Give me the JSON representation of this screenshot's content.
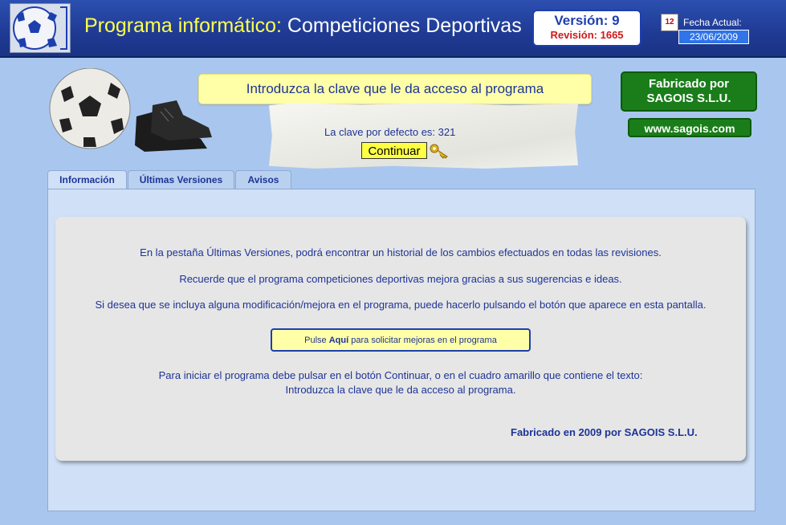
{
  "header": {
    "title_prefix": "Programa informático:",
    "title_main": "Competiciones Deportivas",
    "version_label": "Versión:",
    "version_value": "9",
    "revision_label": "Revisión:",
    "revision_value": "1665",
    "date_label": "Fecha Actual:",
    "date_value": "23/06/2009",
    "calendar_day": "12"
  },
  "login": {
    "prompt": "Introduzca la clave que le da acceso al programa",
    "default_key_text": "La clave por defecto es: 321",
    "continue_label": "Continuar"
  },
  "vendor": {
    "made_by_line1": "Fabricado por",
    "made_by_line2": "SAGOIS S.L.U.",
    "website": "www.sagois.com"
  },
  "tabs": [
    {
      "label": "Información",
      "active": true
    },
    {
      "label": "Últimas Versiones",
      "active": false
    },
    {
      "label": "Avisos",
      "active": false
    }
  ],
  "info": {
    "line1": "En la pestaña Últimas Versiones, podrá encontrar un historial de los cambios efectuados en todas las revisiones.",
    "line2": "Recuerde que el programa competiciones deportivas mejora gracias a sus sugerencias e ideas.",
    "line3": "Si desea que se incluya alguna modificación/mejora en el programa, puede hacerlo pulsando el botón que aparece en esta pantalla.",
    "request_pre": "Pulse ",
    "request_bold": "Aquí",
    "request_post": " para solicitar mejoras en el programa",
    "line4": "Para iniciar el programa debe pulsar en el botón Continuar, o en el cuadro amarillo que contiene el texto:",
    "line5": "Introduzca la clave que le da acceso al programa.",
    "footer": "Fabricado en 2009 por SAGOIS S.L.U."
  },
  "colors": {
    "background": "#a9c7ee",
    "header": "#1f3a93",
    "accent_yellow": "#ffffa8",
    "green": "#1a7d1a",
    "text_blue": "#1d3496"
  },
  "icons": [
    "soccer-logo-icon",
    "calendar-icon",
    "key-icon",
    "soccer-ball-icon",
    "boots-icon"
  ]
}
